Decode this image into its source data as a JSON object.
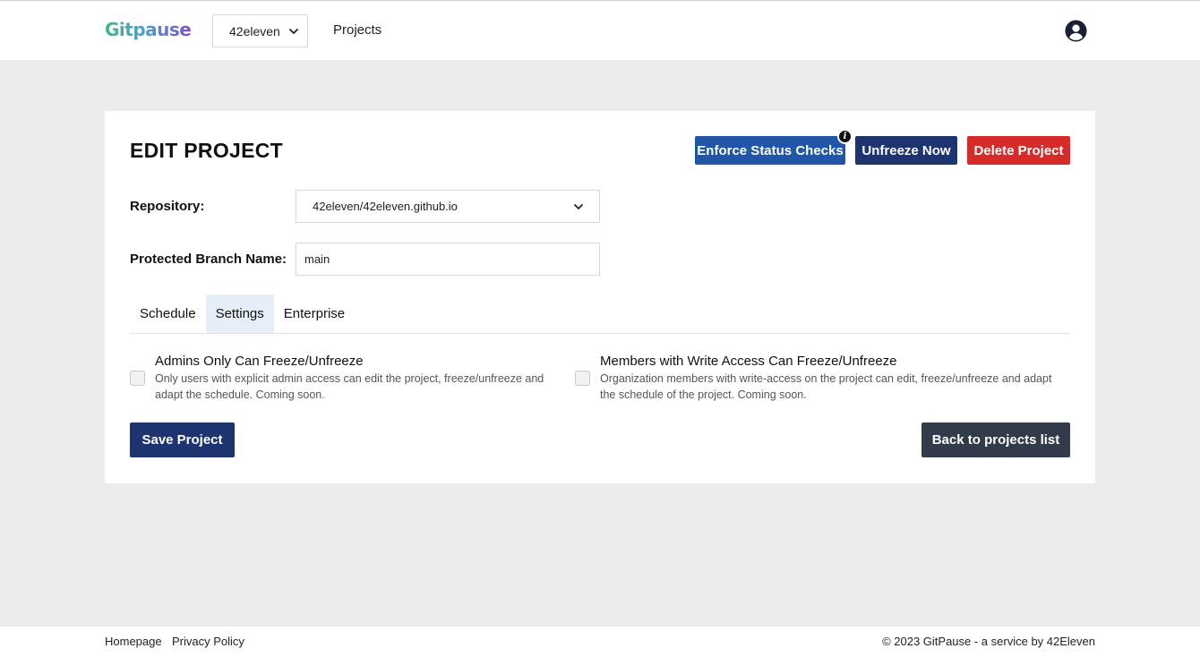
{
  "header": {
    "logo_text": "Gitpause",
    "org_selector": "42eleven",
    "nav_projects": "Projects"
  },
  "page": {
    "title": "EDIT PROJECT",
    "buttons": {
      "enforce": "Enforce Status Checks",
      "unfreeze": "Unfreeze Now",
      "delete": "Delete Project",
      "save": "Save Project",
      "back": "Back to projects list"
    },
    "info_glyph": "i",
    "repository": {
      "label": "Repository:",
      "value": "42eleven/42eleven.github.io"
    },
    "branch": {
      "label": "Protected Branch Name:",
      "value": "main"
    },
    "tabs": [
      {
        "label": "Schedule",
        "active": false
      },
      {
        "label": "Settings",
        "active": true
      },
      {
        "label": "Enterprise",
        "active": false
      }
    ],
    "options": {
      "admins": {
        "title": "Admins Only Can Freeze/Unfreeze",
        "description": "Only users with explicit admin access can edit the project, freeze/unfreeze and adapt the schedule. Coming soon.",
        "checked": false
      },
      "members": {
        "title": "Members with Write Access Can Freeze/Unfreeze",
        "description": "Organization members with write-access on the project can edit, freeze/unfreeze and adapt the schedule of the project. Coming soon.",
        "checked": false
      }
    }
  },
  "footer": {
    "homepage": "Homepage",
    "privacy": "Privacy Policy",
    "copyright": "© 2023 GitPause - a service by 42Eleven"
  },
  "colors": {
    "primary_dark": "#1d3471",
    "primary_blue": "#1f56a8",
    "danger": "#d62b2b",
    "secondary": "#313b4a",
    "background": "#ebebeb"
  }
}
